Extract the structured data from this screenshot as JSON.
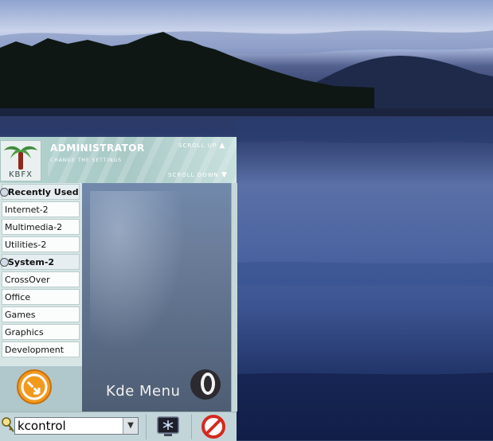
{
  "header": {
    "logo_text": "KBFX",
    "user_label": "ADMINISTRATOR",
    "subtitle": "CHANGE THE SETTINGS",
    "scroll_up_label": "SCROLL UP",
    "scroll_down_label": "SCROLL DOWN"
  },
  "categories": [
    {
      "label": "Recently Used",
      "type": "group"
    },
    {
      "label": "Internet-2",
      "type": "item"
    },
    {
      "label": "Multimedia-2",
      "type": "item"
    },
    {
      "label": "Utilities-2",
      "type": "item"
    },
    {
      "label": "System-2",
      "type": "group"
    },
    {
      "label": "CrossOver",
      "type": "item"
    },
    {
      "label": "Office",
      "type": "item"
    },
    {
      "label": "Games",
      "type": "item"
    },
    {
      "label": "Graphics",
      "type": "item"
    },
    {
      "label": "Development",
      "type": "item"
    }
  ],
  "preview": {
    "title": "Kde Menu"
  },
  "search": {
    "value": "kcontrol"
  },
  "icons": {
    "logo": "palm-tree-icon",
    "search": "magnifier-key-icon",
    "kde_ring": "ring-icon",
    "launch": "orange-arrows-icon",
    "lock": "monitor-lock-icon",
    "logout": "no-entry-icon"
  },
  "colors": {
    "banner": "#b3d3d0",
    "panel": "#c2d5d9",
    "logout_red": "#d42a1f",
    "launch_orange": "#f29a1e"
  }
}
